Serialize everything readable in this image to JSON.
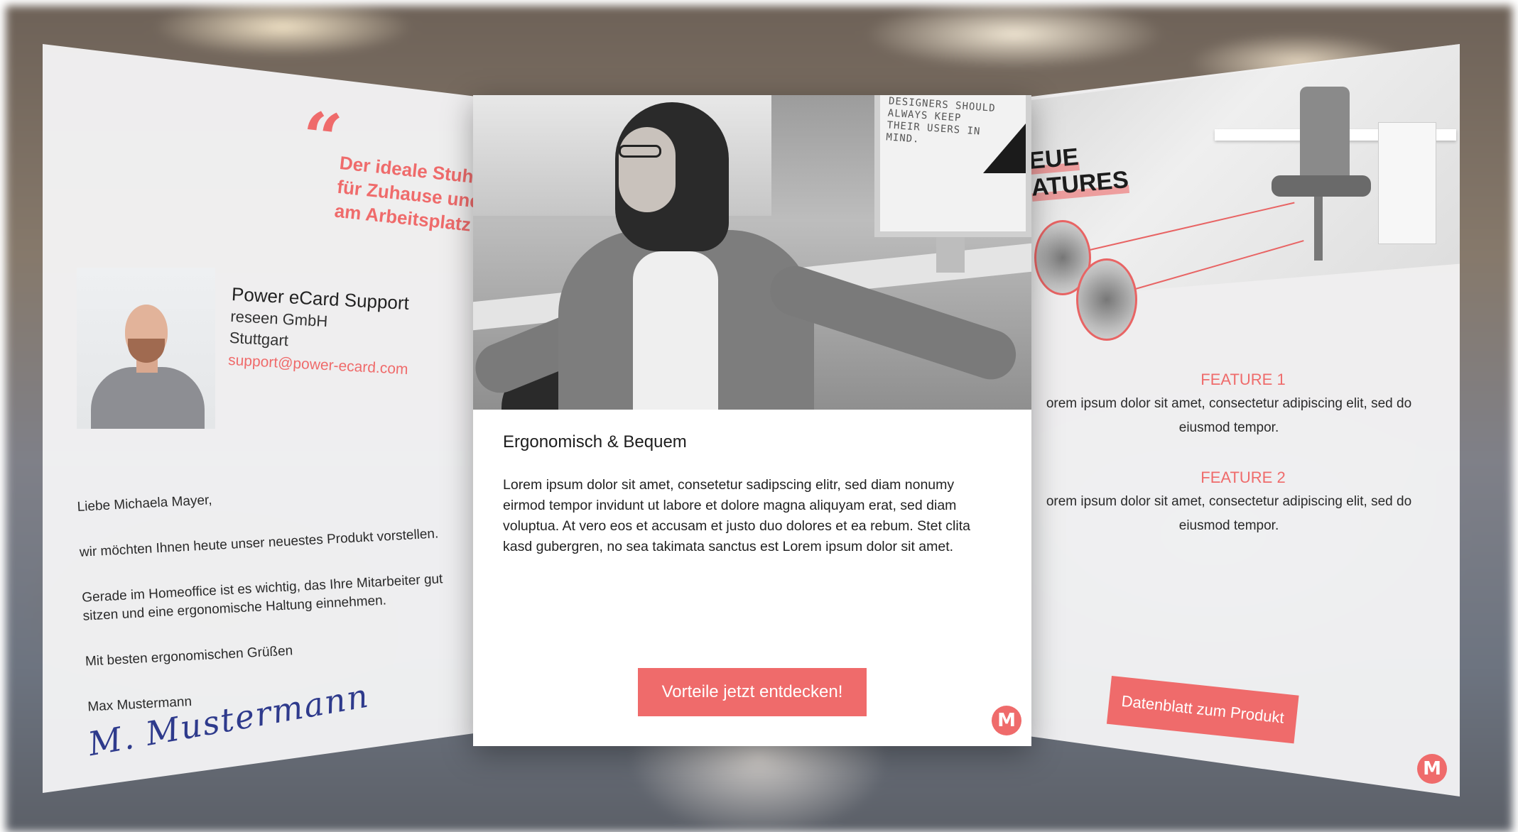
{
  "left_card": {
    "quote_mark": "“",
    "quote_line1": "Der ideale Stuhl",
    "quote_line2": "für Zuhause und",
    "quote_line3": "am Arbeitsplatz",
    "contact": {
      "name": "Power eCard Support",
      "company": "reseen GmbH",
      "city": "Stuttgart",
      "email": "support@power-ecard.com"
    },
    "letter": {
      "greeting": "Liebe Michaela Mayer,",
      "paragraph1": "wir möchten Ihnen heute unser neuestes Produkt vorstellen.",
      "paragraph2": "Gerade im Homeoffice ist es wichtig, das Ihre Mitarbeiter gut sitzen und eine ergonomische Haltung einnehmen.",
      "closing": "Mit besten ergonomischen Grüßen",
      "sender": "Max Mustermann",
      "signature": "M. Mustermann"
    }
  },
  "center_card": {
    "monitor_text": "DESIGNERS SHOULD ALWAYS KEEP THEIR USERS IN MIND.",
    "title": "Ergonomisch & Bequem",
    "body": "Lorem ipsum dolor sit amet, consetetur sadipscing elitr, sed diam nonumy eirmod tempor invidunt ut labore et dolore magna aliquyam erat, sed diam voluptua. At vero eos et accusam et justo duo dolores et ea rebum. Stet clita kasd gubergren, no sea takimata sanctus est Lorem ipsum dolor sit amet.",
    "cta_label": "Vorteile jetzt entdecken!",
    "logo_letter": "M"
  },
  "right_card": {
    "heading_line1": "EUE",
    "heading_line2": "ATURES",
    "feature1_title": "FEATURE 1",
    "feature1_body": "orem ipsum dolor sit amet, consectetur adipiscing elit, sed do eiusmod tempor.",
    "feature2_title": "FEATURE 2",
    "feature2_body": "orem ipsum dolor sit amet, consectetur adipiscing elit, sed do eiusmod tempor.",
    "cta_label": "Datenblatt zum Produkt",
    "logo_letter": "M"
  },
  "colors": {
    "accent": "#ef6b6b",
    "text": "#1d1d1d",
    "card_bg": "#ffffff"
  }
}
